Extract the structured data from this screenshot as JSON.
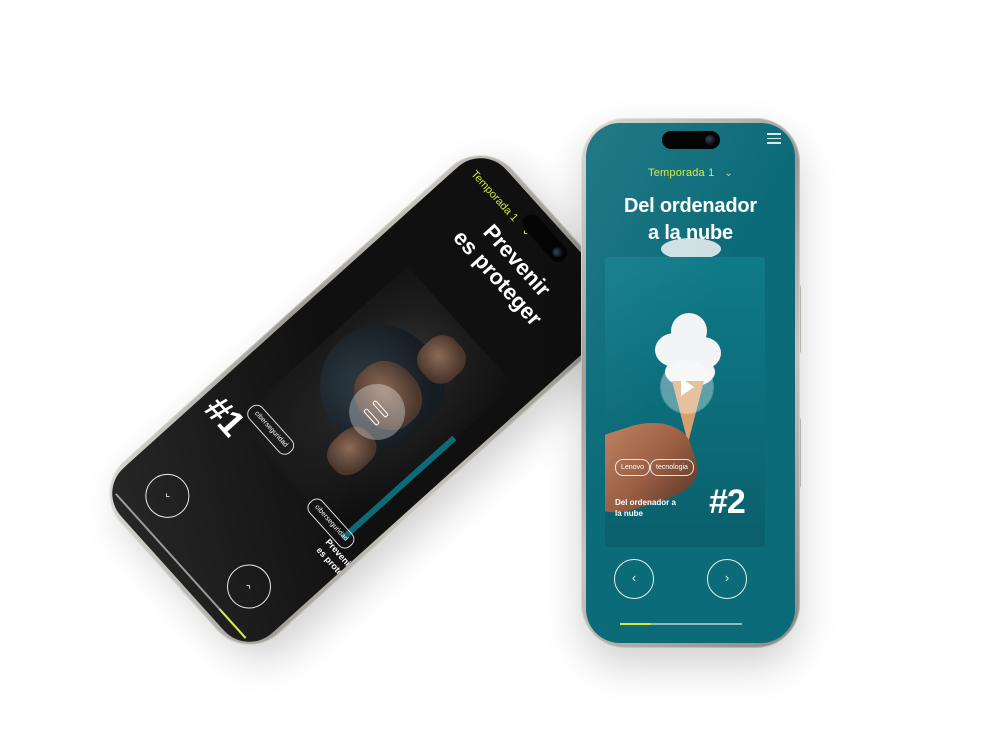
{
  "phone_left": {
    "season_label": "Temporada 1",
    "season_chevron": "⌄",
    "title_line1": "Prevenir",
    "title_line2": "es proteger",
    "tags": [
      "ciberseguridad",
      "ciberseguridad"
    ],
    "card_title_line1": "Prevenir",
    "card_title_line2": "es proteger",
    "episode_number": "#1",
    "nav_prev": "‹",
    "nav_next": "›",
    "progress": 0.2
  },
  "phone_right": {
    "season_label": "Temporada 1",
    "season_chevron": "⌄",
    "title_line1": "Del ordenador",
    "title_line2": "a la nube",
    "tags": [
      "Lenovo",
      "tecnologia"
    ],
    "card_title_line1": "Del ordenador a",
    "card_title_line2": "la nube",
    "episode_number": "#2",
    "nav_prev": "‹",
    "nav_next": "›",
    "progress": 0.25
  },
  "colors": {
    "accent": "#d6e83a",
    "teal": "#0b6b79",
    "dark": "#101010"
  },
  "icons": {
    "menu": "hamburger-menu-icon",
    "play": "play-icon",
    "pause": "pause-icon",
    "chevron": "chevron-down-icon"
  }
}
